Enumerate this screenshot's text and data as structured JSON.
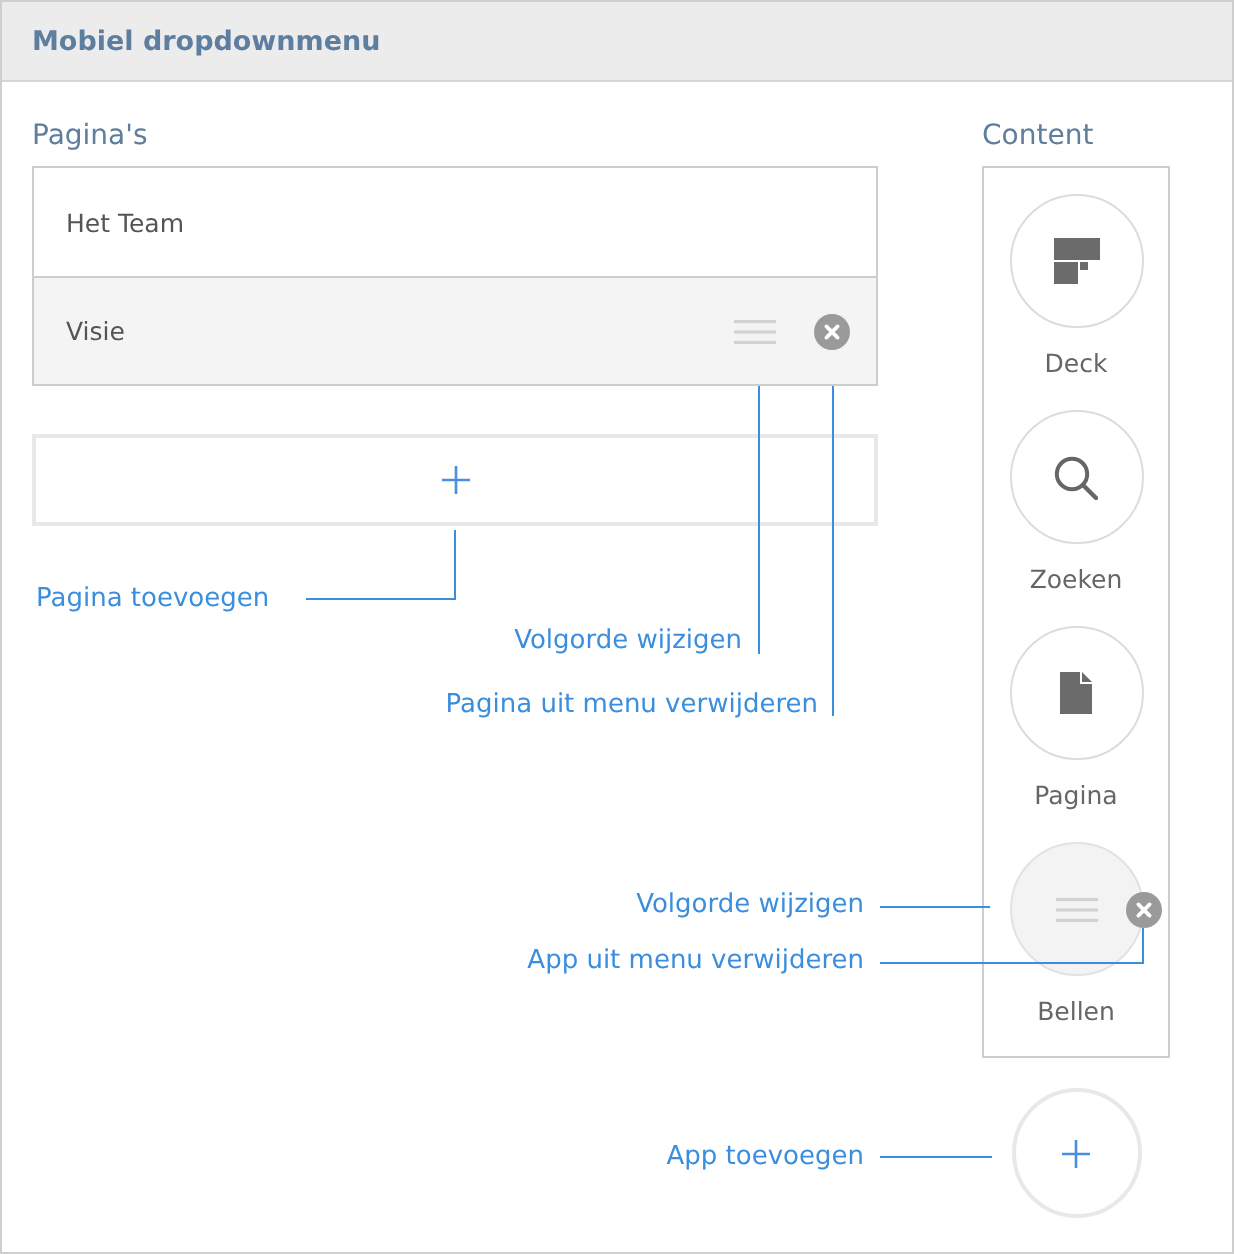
{
  "window": {
    "title": "Mobiel dropdownmenu"
  },
  "pages": {
    "heading": "Pagina's",
    "items": [
      {
        "label": "Het Team",
        "selected": false
      },
      {
        "label": "Visie",
        "selected": true
      }
    ]
  },
  "content": {
    "heading": "Content",
    "apps": [
      {
        "label": "Deck",
        "kind": "deck",
        "selected": false
      },
      {
        "label": "Zoeken",
        "kind": "search",
        "selected": false
      },
      {
        "label": "Pagina",
        "kind": "page",
        "selected": false
      },
      {
        "label": "Bellen",
        "selected": true
      }
    ]
  },
  "annotations": [
    {
      "text": "Pagina toevoegen",
      "kind": "addpage"
    },
    {
      "text": "Volgorde wijzigen",
      "kind": "pagehandle"
    },
    {
      "text": "Pagina uit menu verwijderen",
      "kind": "pageremove"
    },
    {
      "text": "Volgorde wijzigen",
      "kind": "apphandle"
    },
    {
      "text": "App uit menu verwijderen",
      "kind": "appremove"
    },
    {
      "text": "App toevoegen",
      "kind": "addapp"
    }
  ]
}
